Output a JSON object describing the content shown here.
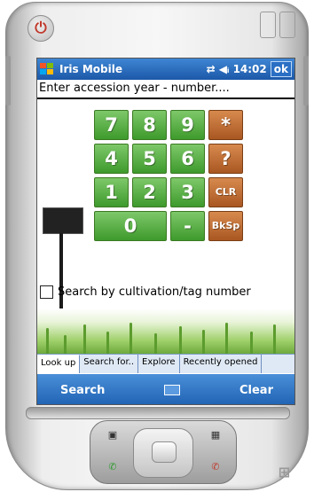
{
  "window": {
    "title": "Iris Mobile",
    "time": "14:02",
    "ok_label": "ok"
  },
  "entry": {
    "text": "Enter accession year - number...."
  },
  "keypad": {
    "keys": [
      "7",
      "8",
      "9",
      "*",
      "4",
      "5",
      "6",
      "?",
      "1",
      "2",
      "3",
      "CLR",
      "0",
      "-",
      "BkSp"
    ]
  },
  "option": {
    "label": "Search by cultivation/tag number",
    "checked": false
  },
  "tabs": [
    "Look up",
    "Search for..",
    "Explore",
    "Recently opened"
  ],
  "softkeys": {
    "left": "Search",
    "right": "Clear"
  },
  "colors": {
    "green_key": "#4ea83a",
    "orange_key": "#b9642b",
    "title_bar": "#1c58a8",
    "soft_bar": "#2e74c4"
  }
}
